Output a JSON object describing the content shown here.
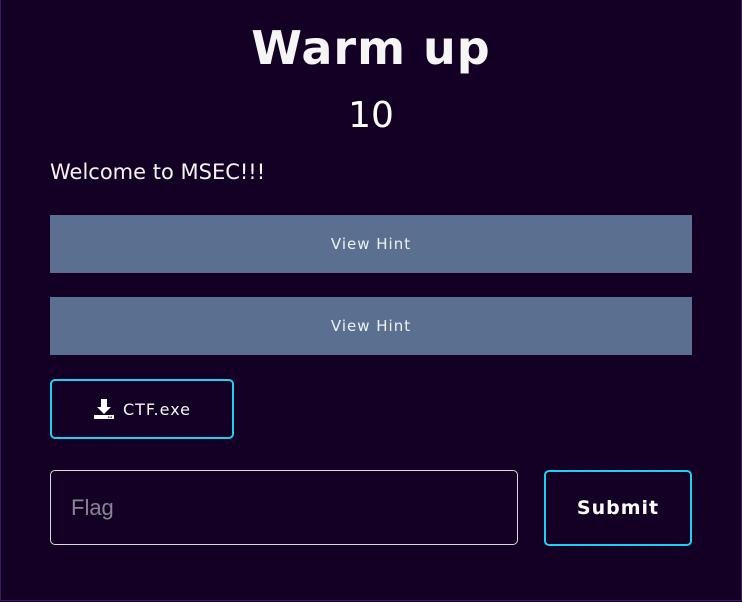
{
  "challenge": {
    "title": "Warm up",
    "points": "10",
    "description": "Welcome to MSEC!!!"
  },
  "hints": [
    {
      "label": "View Hint"
    },
    {
      "label": "View Hint"
    }
  ],
  "file": {
    "name": "CTF.exe",
    "icon": "download-icon"
  },
  "flag_form": {
    "placeholder": "Flag",
    "value": "",
    "submit_label": "Submit"
  },
  "colors": {
    "background": "#140024",
    "hint_button": "#5b7090",
    "accent_border": "#1fd0f0"
  }
}
